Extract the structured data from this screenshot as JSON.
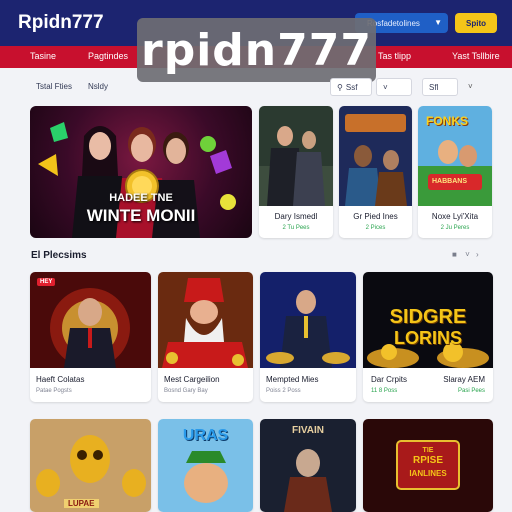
{
  "header": {
    "logo": "Rpidn777",
    "search_label": "Rosfadetolines",
    "signin_label": "Spito"
  },
  "nav": {
    "items": [
      "Tasine",
      "Pagtindes",
      "Tas tlipp",
      "Yast Tsllbire"
    ]
  },
  "watermark": "rpidn777",
  "filters": {
    "tabs": [
      "Tstal Fties",
      "Nsldy"
    ],
    "search_placeholder": "Ssf",
    "sort_label": "Sfl"
  },
  "hero": {
    "line1": "HADEE TNE",
    "line2": "WINTE MONII"
  },
  "featured": [
    {
      "title": "Dary Ismedl",
      "sub": "2 Tu Pees"
    },
    {
      "title": "Gr Pied Ines",
      "sub": "2 Pices"
    },
    {
      "title": "Noxe Lyi'Xita",
      "sub": "2 Ju Peres"
    }
  ],
  "featured_thumb_texts": [
    "FONKS",
    "HABBANS"
  ],
  "section": {
    "title": "El Plecsims"
  },
  "grid": [
    {
      "title": "Haeft Colatas",
      "sub": "Patae Pogsts",
      "badge": "HEY"
    },
    {
      "title": "Mest Cargeilion",
      "sub": "Bosnd Gary Bay"
    },
    {
      "title": "Mempted Mies",
      "sub": "Poiss 2 Poss"
    },
    {
      "title": "Dar Crpits",
      "sub": "11 8 Poss"
    },
    {
      "title": "Slaray AEM",
      "sub": "Pasi Pees"
    }
  ],
  "grid_thumb_texts": {
    "slot4_line1": "SIDGRE",
    "slot4_line2": "LORINS",
    "bottom2": "URAS",
    "bottom3": "FIVAIN",
    "bottom4_line1": "TIE",
    "bottom4_line2": "RPISE",
    "bottom4_line3": "IANLINES",
    "bottom1": "LUPAE"
  }
}
